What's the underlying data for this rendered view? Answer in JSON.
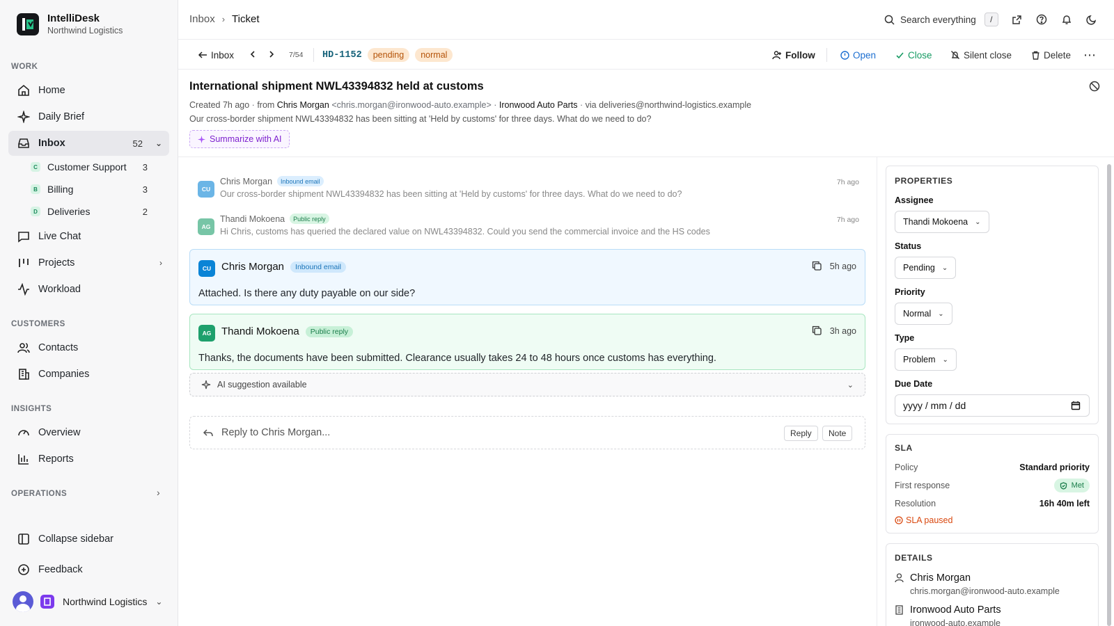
{
  "app": {
    "name": "IntelliDesk",
    "org": "Northwind Logistics"
  },
  "sidebar": {
    "sections": {
      "work": "WORK",
      "customers": "CUSTOMERS",
      "insights": "INSIGHTS",
      "operations": "OPERATIONS"
    },
    "items": {
      "home": "Home",
      "daily_brief": "Daily Brief",
      "inbox": "Inbox",
      "inbox_count": "52",
      "live_chat": "Live Chat",
      "projects": "Projects",
      "workload": "Workload",
      "contacts": "Contacts",
      "companies": "Companies",
      "overview": "Overview",
      "reports": "Reports"
    },
    "inbox_children": [
      {
        "badge": "C",
        "label": "Customer Support",
        "count": "3"
      },
      {
        "badge": "B",
        "label": "Billing",
        "count": "3"
      },
      {
        "badge": "D",
        "label": "Deliveries",
        "count": "2"
      }
    ],
    "collapse": "Collapse sidebar",
    "feedback": "Feedback",
    "workspace": "Northwind Logistics"
  },
  "topbar": {
    "breadcrumb": [
      "Inbox",
      "Ticket"
    ],
    "search": "Search everything",
    "search_kbd": "/"
  },
  "toolbar": {
    "back": "Inbox",
    "position": "7/54",
    "ticket_id": "HD-1152",
    "status_pill": "pending",
    "priority_pill": "normal",
    "follow": "Follow",
    "open": "Open",
    "close": "Close",
    "silent_close": "Silent close",
    "delete": "Delete"
  },
  "ticket": {
    "subject": "International shipment NWL43394832 held at customs",
    "created": "Created 7h ago",
    "from_prefix": "from",
    "from_name": "Chris Morgan",
    "from_email": "<chris.morgan@ironwood-auto.example>",
    "company": "Ironwood Auto Parts",
    "via": "via deliveries@northwind-logistics.example",
    "preview": "Our cross-border shipment NWL43394832 has been sitting at 'Held by customs' for three days. What do we need to do?",
    "summarize": "Summarize with AI"
  },
  "thread": {
    "compact": [
      {
        "initials": "CU",
        "name": "Chris Morgan",
        "tag": "Inbound email",
        "time": "7h ago",
        "text": "Our cross-border shipment NWL43394832 has been sitting at 'Held by customs' for three days. What do we need to do?"
      },
      {
        "initials": "AG",
        "name": "Thandi Mokoena",
        "tag": "Public reply",
        "time": "7h ago",
        "text": "Hi Chris, customs has queried the declared value on NWL43394832. Could you send the commercial invoice and the HS codes"
      }
    ],
    "cards": [
      {
        "initials": "CU",
        "name": "Chris Morgan",
        "tag": "Inbound email",
        "time": "5h ago",
        "body": "Attached. Is there any duty payable on our side?"
      },
      {
        "initials": "AG",
        "name": "Thandi Mokoena",
        "tag": "Public reply",
        "time": "3h ago",
        "body": "Thanks, the documents have been submitted. Clearance usually takes 24 to 48 hours once customs has everything."
      }
    ],
    "ai_suggestion": "AI suggestion available",
    "reply_placeholder": "Reply to Chris Morgan...",
    "reply_btn": "Reply",
    "note_btn": "Note"
  },
  "properties": {
    "title": "PROPERTIES",
    "assignee_label": "Assignee",
    "assignee": "Thandi Mokoena",
    "status_label": "Status",
    "status": "Pending",
    "priority_label": "Priority",
    "priority": "Normal",
    "type_label": "Type",
    "type": "Problem",
    "due_label": "Due Date",
    "due_placeholder": "yyyy / mm / dd"
  },
  "sla": {
    "title": "SLA",
    "policy_label": "Policy",
    "policy": "Standard priority",
    "first_response_label": "First response",
    "first_response": "Met",
    "resolution_label": "Resolution",
    "resolution": "16h 40m left",
    "paused": "SLA paused"
  },
  "details": {
    "title": "DETAILS",
    "contact_name": "Chris Morgan",
    "contact_email": "chris.morgan@ironwood-auto.example",
    "company_name": "Ironwood Auto Parts",
    "company_domain": "ironwood-auto.example"
  }
}
